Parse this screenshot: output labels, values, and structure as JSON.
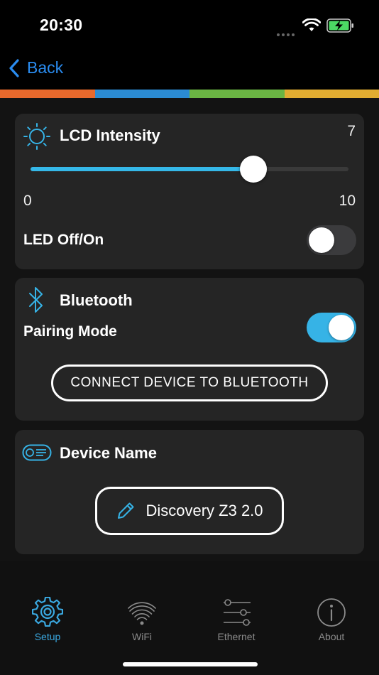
{
  "status_bar": {
    "time": "20:30"
  },
  "nav": {
    "back_label": "Back"
  },
  "colors": {
    "strip": [
      "#e8692c",
      "#2b8bd3",
      "#6ab543",
      "#e1ac31"
    ],
    "accent": "#36b3e6",
    "link": "#2a8cf0"
  },
  "lcd": {
    "title": "LCD Intensity",
    "value": "7",
    "min": "0",
    "max": "10",
    "slider_fraction": 0.7,
    "led_label": "LED Off/On",
    "led_on": false,
    "icon": "sun-icon"
  },
  "bluetooth": {
    "title": "Bluetooth",
    "pairing_label": "Pairing Mode",
    "pairing_on": true,
    "connect_label": "CONNECT DEVICE TO BLUETOOTH",
    "icon": "bluetooth-icon"
  },
  "device": {
    "title": "Device Name",
    "name": "Discovery Z3 2.0",
    "icon": "device-tag-icon",
    "edit_icon": "pencil-icon"
  },
  "tabs": [
    {
      "label": "Setup",
      "icon": "gear-icon",
      "active": true
    },
    {
      "label": "WiFi",
      "icon": "wifi-icon",
      "active": false
    },
    {
      "label": "Ethernet",
      "icon": "sliders-icon",
      "active": false
    },
    {
      "label": "About",
      "icon": "info-icon",
      "active": false
    }
  ]
}
